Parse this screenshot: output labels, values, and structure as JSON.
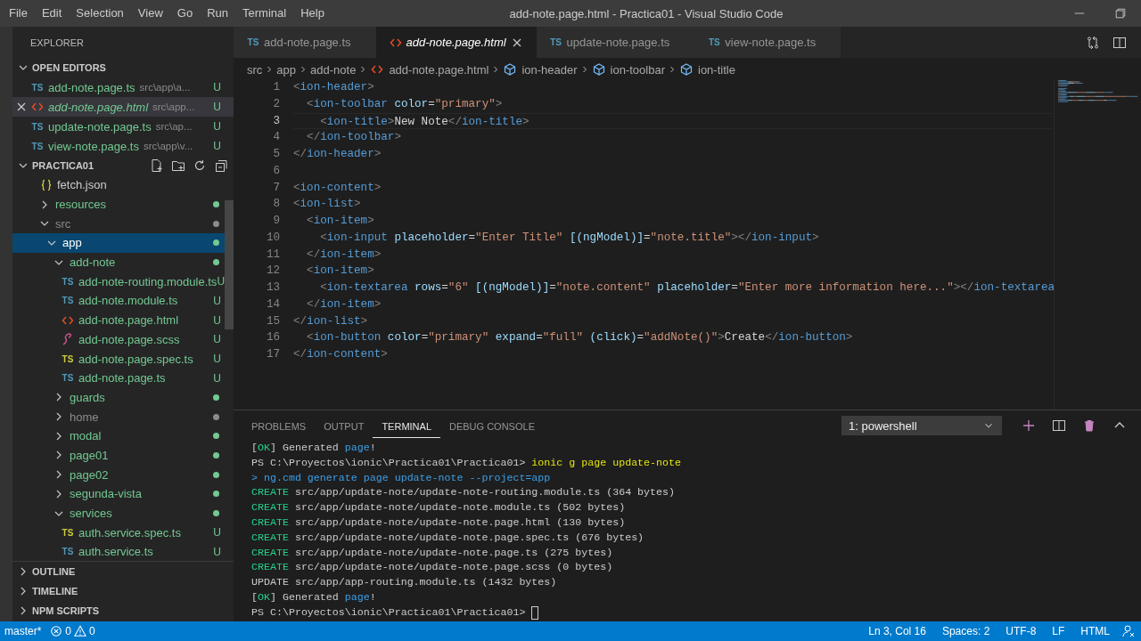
{
  "window": {
    "title": "add-note.page.html - Practica01 - Visual Studio Code"
  },
  "menu": [
    "File",
    "Edit",
    "Selection",
    "View",
    "Go",
    "Run",
    "Terminal",
    "Help"
  ],
  "sidebar": {
    "title": "EXPLORER",
    "open_editors": {
      "title": "OPEN EDITORS",
      "expanded": true,
      "items": [
        {
          "name": "add-note.page.ts",
          "kind": "ts",
          "icon_label": "TS",
          "path": "src\\app\\a...",
          "badge": "U",
          "selected": false,
          "preview": false
        },
        {
          "name": "add-note.page.html",
          "kind": "html",
          "path": "src\\app...",
          "badge": "U",
          "selected": true,
          "preview": true
        },
        {
          "name": "update-note.page.ts",
          "kind": "ts",
          "icon_label": "TS",
          "path": "src\\ap...",
          "badge": "U",
          "selected": false,
          "preview": false
        },
        {
          "name": "view-note.page.ts",
          "kind": "ts",
          "icon_label": "TS",
          "path": "src\\app\\v...",
          "badge": "U",
          "selected": false,
          "preview": false
        }
      ]
    },
    "project": {
      "title": "PRACTICA01",
      "expanded": true,
      "tree": [
        {
          "name": "fetch.json",
          "kind": "json",
          "selected": false
        },
        {
          "name": "resources",
          "kind": "folder",
          "expanded": false,
          "selected": false,
          "color": "#73c991"
        },
        {
          "name": "src",
          "kind": "folder",
          "expanded": true,
          "selected": false,
          "color": "#8c8c8c",
          "children": [
            {
              "name": "app",
              "kind": "folder",
              "expanded": true,
              "selected": true,
              "color": "#73c991",
              "children": [
                {
                  "name": "add-note",
                  "kind": "folder",
                  "expanded": true,
                  "selected": false,
                  "color": "#73c991",
                  "children": [
                    {
                      "name": "add-note-routing.module.ts",
                      "kind": "ts",
                      "icon_label": "TS",
                      "badge": "U",
                      "selected": false,
                      "color": "#73c991"
                    },
                    {
                      "name": "add-note.module.ts",
                      "kind": "ts",
                      "icon_label": "TS",
                      "badge": "U",
                      "selected": false,
                      "color": "#73c991"
                    },
                    {
                      "name": "add-note.page.html",
                      "kind": "html",
                      "badge": "U",
                      "selected": false,
                      "color": "#73c991"
                    },
                    {
                      "name": "add-note.page.scss",
                      "kind": "scss",
                      "badge": "U",
                      "selected": false,
                      "color": "#73c991"
                    },
                    {
                      "name": "add-note.page.spec.ts",
                      "kind": "spec",
                      "icon_label": "TS",
                      "badge": "U",
                      "selected": false,
                      "color": "#73c991"
                    },
                    {
                      "name": "add-note.page.ts",
                      "kind": "ts",
                      "icon_label": "TS",
                      "badge": "U",
                      "selected": false,
                      "color": "#73c991"
                    }
                  ]
                },
                {
                  "name": "guards",
                  "kind": "folder",
                  "expanded": false,
                  "selected": false,
                  "color": "#73c991"
                },
                {
                  "name": "home",
                  "kind": "folder",
                  "expanded": false,
                  "selected": false,
                  "color": "#8c8c8c"
                },
                {
                  "name": "modal",
                  "kind": "folder",
                  "expanded": false,
                  "selected": false,
                  "color": "#73c991"
                },
                {
                  "name": "page01",
                  "kind": "folder",
                  "expanded": false,
                  "selected": false,
                  "color": "#73c991"
                },
                {
                  "name": "page02",
                  "kind": "folder",
                  "expanded": false,
                  "selected": false,
                  "color": "#73c991"
                },
                {
                  "name": "segunda-vista",
                  "kind": "folder",
                  "expanded": false,
                  "selected": false,
                  "color": "#73c991"
                },
                {
                  "name": "services",
                  "kind": "folder",
                  "expanded": true,
                  "selected": false,
                  "color": "#73c991",
                  "children": [
                    {
                      "name": "auth.service.spec.ts",
                      "kind": "spec",
                      "icon_label": "TS",
                      "badge": "U",
                      "selected": false,
                      "color": "#73c991"
                    },
                    {
                      "name": "auth.service.ts",
                      "kind": "ts",
                      "icon_label": "TS",
                      "badge": "U",
                      "selected": false,
                      "color": "#73c991"
                    }
                  ]
                }
              ]
            }
          ]
        }
      ]
    },
    "sections": [
      {
        "title": "OUTLINE",
        "expanded": false
      },
      {
        "title": "TIMELINE",
        "expanded": false
      },
      {
        "title": "NPM SCRIPTS",
        "expanded": false
      }
    ]
  },
  "tabs": [
    {
      "label": "add-note.page.ts",
      "kind": "ts",
      "icon_label": "TS",
      "selected": false,
      "preview": false
    },
    {
      "label": "add-note.page.html",
      "kind": "html",
      "selected": true,
      "preview": true
    },
    {
      "label": "update-note.page.ts",
      "kind": "ts",
      "icon_label": "TS",
      "selected": false,
      "preview": false
    },
    {
      "label": "view-note.page.ts",
      "kind": "ts",
      "icon_label": "TS",
      "selected": false,
      "preview": false
    }
  ],
  "breadcrumbs": [
    {
      "label": "src",
      "kind": "folder"
    },
    {
      "label": "app",
      "kind": "folder"
    },
    {
      "label": "add-note",
      "kind": "folder"
    },
    {
      "label": "add-note.page.html",
      "kind": "html"
    },
    {
      "label": "ion-header",
      "kind": "element"
    },
    {
      "label": "ion-toolbar",
      "kind": "element"
    },
    {
      "label": "ion-title",
      "kind": "element"
    }
  ],
  "editor": {
    "lines": [
      {
        "number": "1",
        "current": false,
        "tokens": [
          {
            "kind": "punct",
            "text": "<"
          },
          {
            "kind": "tag",
            "text": "ion-header"
          },
          {
            "kind": "punct",
            "text": ">"
          }
        ]
      },
      {
        "number": "2",
        "current": false,
        "tokens": [
          {
            "kind": "punct",
            "text": "  <"
          },
          {
            "kind": "tag",
            "text": "ion-toolbar"
          },
          {
            "kind": "attr",
            "text": " color"
          },
          {
            "kind": "plain",
            "text": "="
          },
          {
            "kind": "string",
            "text": "\"primary\""
          },
          {
            "kind": "punct",
            "text": ">"
          }
        ]
      },
      {
        "number": "3",
        "current": true,
        "tokens": [
          {
            "kind": "punct",
            "text": "    <"
          },
          {
            "kind": "tag",
            "text": "ion-title"
          },
          {
            "kind": "punct",
            "text": ">"
          },
          {
            "kind": "plain",
            "text": "New Note"
          },
          {
            "kind": "punct",
            "text": "</"
          },
          {
            "kind": "tag",
            "text": "ion-title"
          },
          {
            "kind": "punct",
            "text": ">"
          }
        ]
      },
      {
        "number": "4",
        "current": false,
        "tokens": [
          {
            "kind": "punct",
            "text": "  </"
          },
          {
            "kind": "tag",
            "text": "ion-toolbar"
          },
          {
            "kind": "punct",
            "text": ">"
          }
        ]
      },
      {
        "number": "5",
        "current": false,
        "tokens": [
          {
            "kind": "punct",
            "text": "</"
          },
          {
            "kind": "tag",
            "text": "ion-header"
          },
          {
            "kind": "punct",
            "text": ">"
          }
        ]
      },
      {
        "number": "6",
        "current": false
      },
      {
        "number": "7",
        "current": false,
        "tokens": [
          {
            "kind": "punct",
            "text": "<"
          },
          {
            "kind": "tag",
            "text": "ion-content"
          },
          {
            "kind": "punct",
            "text": ">"
          }
        ]
      },
      {
        "number": "8",
        "current": false,
        "tokens": [
          {
            "kind": "punct",
            "text": "<"
          },
          {
            "kind": "tag",
            "text": "ion-list"
          },
          {
            "kind": "punct",
            "text": ">"
          }
        ]
      },
      {
        "number": "9",
        "current": false,
        "tokens": [
          {
            "kind": "punct",
            "text": "  <"
          },
          {
            "kind": "tag",
            "text": "ion-item"
          },
          {
            "kind": "punct",
            "text": ">"
          }
        ]
      },
      {
        "number": "10",
        "current": false,
        "tokens": [
          {
            "kind": "punct",
            "text": "    <"
          },
          {
            "kind": "tag",
            "text": "ion-input"
          },
          {
            "kind": "attr",
            "text": " placeholder"
          },
          {
            "kind": "plain",
            "text": "="
          },
          {
            "kind": "string",
            "text": "\"Enter Title\""
          },
          {
            "kind": "attr",
            "text": " [(ngModel)]"
          },
          {
            "kind": "plain",
            "text": "="
          },
          {
            "kind": "string",
            "text": "\"note.title\""
          },
          {
            "kind": "punct",
            "text": "></"
          },
          {
            "kind": "tag",
            "text": "ion-input"
          },
          {
            "kind": "punct",
            "text": ">"
          }
        ]
      },
      {
        "number": "11",
        "current": false,
        "tokens": [
          {
            "kind": "punct",
            "text": "  </"
          },
          {
            "kind": "tag",
            "text": "ion-item"
          },
          {
            "kind": "punct",
            "text": ">"
          }
        ]
      },
      {
        "number": "12",
        "current": false,
        "tokens": [
          {
            "kind": "punct",
            "text": "  <"
          },
          {
            "kind": "tag",
            "text": "ion-item"
          },
          {
            "kind": "punct",
            "text": ">"
          }
        ]
      },
      {
        "number": "13",
        "current": false,
        "tokens": [
          {
            "kind": "punct",
            "text": "    <"
          },
          {
            "kind": "tag",
            "text": "ion-textarea"
          },
          {
            "kind": "attr",
            "text": " rows"
          },
          {
            "kind": "plain",
            "text": "="
          },
          {
            "kind": "string",
            "text": "\"6\""
          },
          {
            "kind": "attr",
            "text": " [(ngModel)]"
          },
          {
            "kind": "plain",
            "text": "="
          },
          {
            "kind": "string",
            "text": "\"note.content\""
          },
          {
            "kind": "attr",
            "text": " placeholder"
          },
          {
            "kind": "plain",
            "text": "="
          },
          {
            "kind": "string",
            "text": "\"Enter more information here...\""
          },
          {
            "kind": "punct",
            "text": "></"
          },
          {
            "kind": "tag",
            "text": "ion-textarea"
          }
        ]
      },
      {
        "number": "14",
        "current": false,
        "tokens": [
          {
            "kind": "punct",
            "text": "  </"
          },
          {
            "kind": "tag",
            "text": "ion-item"
          },
          {
            "kind": "punct",
            "text": ">"
          }
        ]
      },
      {
        "number": "15",
        "current": false,
        "tokens": [
          {
            "kind": "punct",
            "text": "</"
          },
          {
            "kind": "tag",
            "text": "ion-list"
          },
          {
            "kind": "punct",
            "text": ">"
          }
        ]
      },
      {
        "number": "16",
        "current": false,
        "tokens": [
          {
            "kind": "punct",
            "text": "  <"
          },
          {
            "kind": "tag",
            "text": "ion-button"
          },
          {
            "kind": "attr",
            "text": " color"
          },
          {
            "kind": "plain",
            "text": "="
          },
          {
            "kind": "string",
            "text": "\"primary\""
          },
          {
            "kind": "attr",
            "text": " expand"
          },
          {
            "kind": "plain",
            "text": "="
          },
          {
            "kind": "string",
            "text": "\"full\""
          },
          {
            "kind": "attr",
            "text": " (click)"
          },
          {
            "kind": "plain",
            "text": "="
          },
          {
            "kind": "string",
            "text": "\"addNote()\""
          },
          {
            "kind": "punct",
            "text": ">"
          },
          {
            "kind": "plain",
            "text": "Create"
          },
          {
            "kind": "punct",
            "text": "</"
          },
          {
            "kind": "tag",
            "text": "ion-button"
          },
          {
            "kind": "punct",
            "text": ">"
          }
        ]
      },
      {
        "number": "17",
        "current": false,
        "tokens": [
          {
            "kind": "punct",
            "text": "</"
          },
          {
            "kind": "tag",
            "text": "ion-content"
          },
          {
            "kind": "punct",
            "text": ">"
          }
        ]
      }
    ]
  },
  "panel": {
    "tabs": [
      {
        "label": "PROBLEMS",
        "selected": false
      },
      {
        "label": "OUTPUT",
        "selected": false
      },
      {
        "label": "TERMINAL",
        "selected": true
      },
      {
        "label": "DEBUG CONSOLE",
        "selected": false
      }
    ],
    "terminal_select": {
      "value": "1: powershell"
    },
    "terminal": [
      {
        "tokens": [
          {
            "kind": "plain",
            "text": "["
          },
          {
            "kind": "success",
            "text": "OK"
          },
          {
            "kind": "plain",
            "text": "] Generated "
          },
          {
            "kind": "info",
            "text": "page"
          },
          {
            "kind": "plain",
            "text": "!"
          }
        ]
      },
      {
        "tokens": [
          {
            "kind": "plain",
            "text": "PS C:\\Proyectos\\ionic\\Practica01\\Practica01> "
          },
          {
            "kind": "command",
            "text": "ionic g page update-note"
          }
        ]
      },
      {
        "tokens": [
          {
            "kind": "info",
            "text": "> ng.cmd generate page update-note --project=app"
          }
        ]
      },
      {
        "tokens": [
          {
            "kind": "success",
            "text": "CREATE"
          },
          {
            "kind": "plain",
            "text": " src/app/update-note/update-note-routing.module.ts (364 bytes)"
          }
        ]
      },
      {
        "tokens": [
          {
            "kind": "success",
            "text": "CREATE"
          },
          {
            "kind": "plain",
            "text": " src/app/update-note/update-note.module.ts (502 bytes)"
          }
        ]
      },
      {
        "tokens": [
          {
            "kind": "success",
            "text": "CREATE"
          },
          {
            "kind": "plain",
            "text": " src/app/update-note/update-note.page.html (130 bytes)"
          }
        ]
      },
      {
        "tokens": [
          {
            "kind": "success",
            "text": "CREATE"
          },
          {
            "kind": "plain",
            "text": " src/app/update-note/update-note.page.spec.ts (676 bytes)"
          }
        ]
      },
      {
        "tokens": [
          {
            "kind": "success",
            "text": "CREATE"
          },
          {
            "kind": "plain",
            "text": " src/app/update-note/update-note.page.ts (275 bytes)"
          }
        ]
      },
      {
        "tokens": [
          {
            "kind": "success",
            "text": "CREATE"
          },
          {
            "kind": "plain",
            "text": " src/app/update-note/update-note.page.scss (0 bytes)"
          }
        ]
      },
      {
        "tokens": [
          {
            "kind": "plain",
            "text": "UPDATE src/app/app-routing.module.ts (1432 bytes)"
          }
        ]
      },
      {
        "tokens": [
          {
            "kind": "plain",
            "text": "["
          },
          {
            "kind": "success",
            "text": "OK"
          },
          {
            "kind": "plain",
            "text": "] Generated "
          },
          {
            "kind": "info",
            "text": "page"
          },
          {
            "kind": "plain",
            "text": "!"
          }
        ]
      },
      {
        "tokens": [
          {
            "kind": "plain",
            "text": "PS C:\\Proyectos\\ionic\\Practica01\\Practica01> "
          }
        ],
        "cursor": true
      }
    ]
  },
  "status_bar": {
    "branch": "master*",
    "errors": "0",
    "warnings": "0",
    "items": [
      "Ln 3, Col 16",
      "Spaces: 2",
      "UTF-8",
      "LF",
      "HTML"
    ]
  }
}
